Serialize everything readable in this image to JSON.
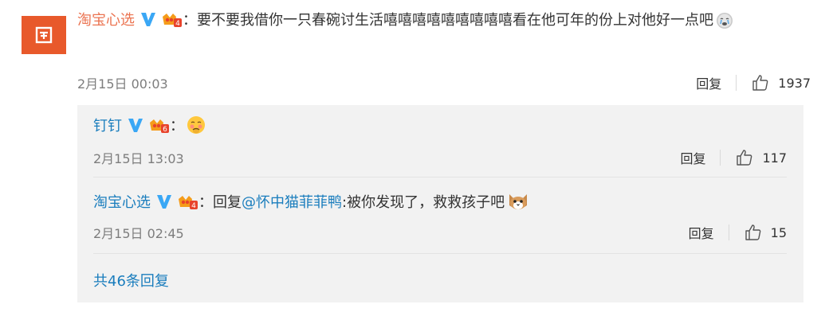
{
  "main_comment": {
    "username": "淘宝心选",
    "text": "：要不要我借你一只春碗讨生活嘻嘻嘻嘻嘻嘻嘻嘻嘻看在他可年的份上对他好一点吧",
    "timestamp": "2月15日 00:03",
    "reply_label": "回复",
    "like_count": "1937"
  },
  "replies": [
    {
      "username": "钉钉",
      "text": "：",
      "timestamp": "2月15日 13:03",
      "reply_label": "回复",
      "like_count": "117"
    },
    {
      "username": "淘宝心选",
      "text_prefix": "：回复",
      "mention": "@怀中猫菲菲鸭",
      "text": ":被你发现了，救救孩子吧",
      "timestamp": "2月15日 02:45",
      "reply_label": "回复",
      "like_count": "15"
    }
  ],
  "more_replies_label": "共46条回复",
  "colors": {
    "accent_orange": "#e8592b",
    "link_blue": "#1a7dbd",
    "verified_blue": "#3aa7f5",
    "reply_bg": "#f2f2f2"
  }
}
